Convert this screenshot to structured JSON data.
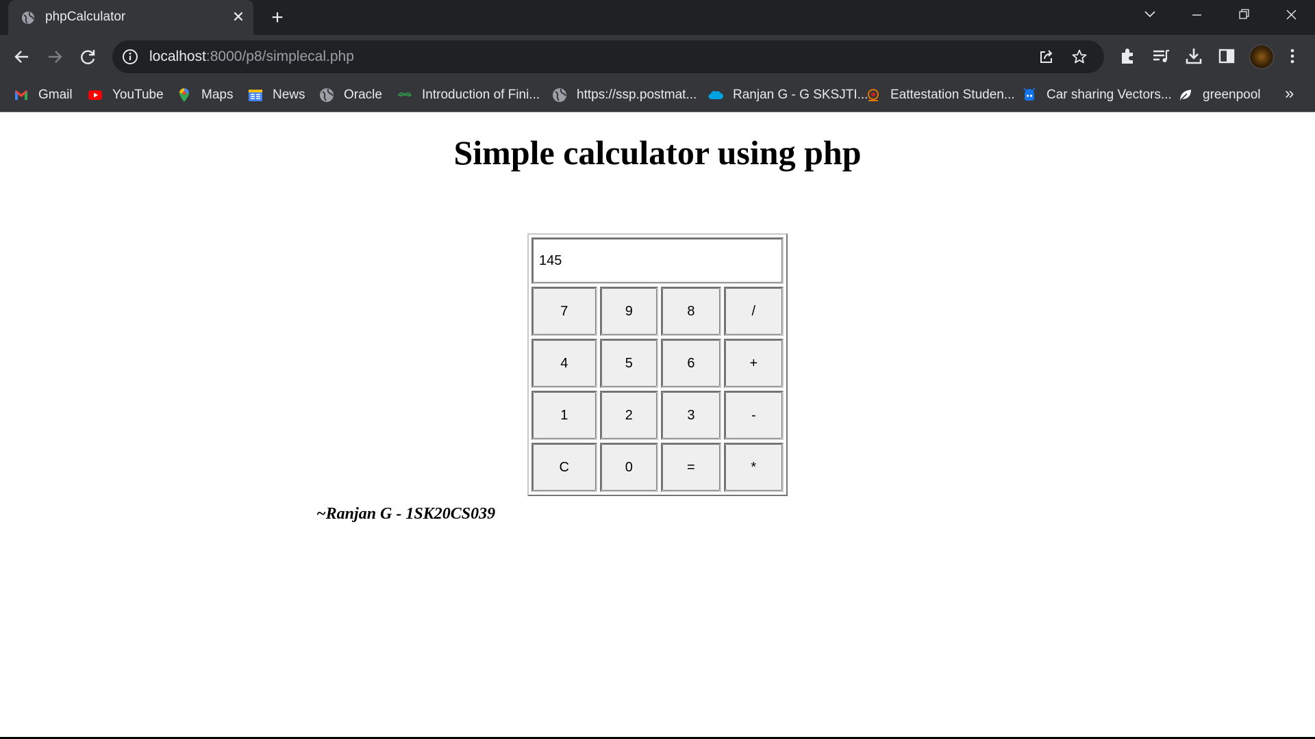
{
  "browser": {
    "tab_title": "phpCalculator",
    "tab_close_glyph": "✕",
    "new_tab_glyph": "+",
    "url_host": "localhost",
    "url_rest": ":8000/p8/simplecal.php",
    "more_bookmarks_glyph": "»",
    "bookmarks": [
      {
        "label": "Gmail",
        "icon": "gmail-icon",
        "color": "#ea4335"
      },
      {
        "label": "YouTube",
        "icon": "youtube-icon",
        "color": "#ff0000"
      },
      {
        "label": "Maps",
        "icon": "maps-icon",
        "color": "#34a853"
      },
      {
        "label": "News",
        "icon": "news-icon",
        "color": "#4285f4"
      },
      {
        "label": "Oracle",
        "icon": "globe-icon",
        "color": "#9aa0a6"
      },
      {
        "label": "Introduction of Fini...",
        "icon": "geeksforgeeks-icon",
        "color": "#2f8d46"
      },
      {
        "label": "https://ssp.postmat...",
        "icon": "globe-icon",
        "color": "#9aa0a6"
      },
      {
        "label": "Ranjan G - G SKSJTI...",
        "icon": "salesforce-cloud-icon",
        "color": "#00a1e0"
      },
      {
        "label": "Eattestation Studen...",
        "icon": "emblem-icon",
        "color": "#e37400"
      },
      {
        "label": "Car sharing Vectors...",
        "icon": "freepik-icon",
        "color": "#1273eb"
      },
      {
        "label": "greenpool",
        "icon": "leaf-icon",
        "color": "#ffffff"
      }
    ]
  },
  "page": {
    "title": "Simple calculator using php",
    "display_value": "145",
    "keys": [
      [
        "7",
        "9",
        "8",
        "/"
      ],
      [
        "4",
        "5",
        "6",
        "+"
      ],
      [
        "1",
        "2",
        "3",
        "-"
      ],
      [
        "C",
        "0",
        "=",
        "*"
      ]
    ],
    "signature": "~Ranjan G - 1SK20CS039"
  }
}
